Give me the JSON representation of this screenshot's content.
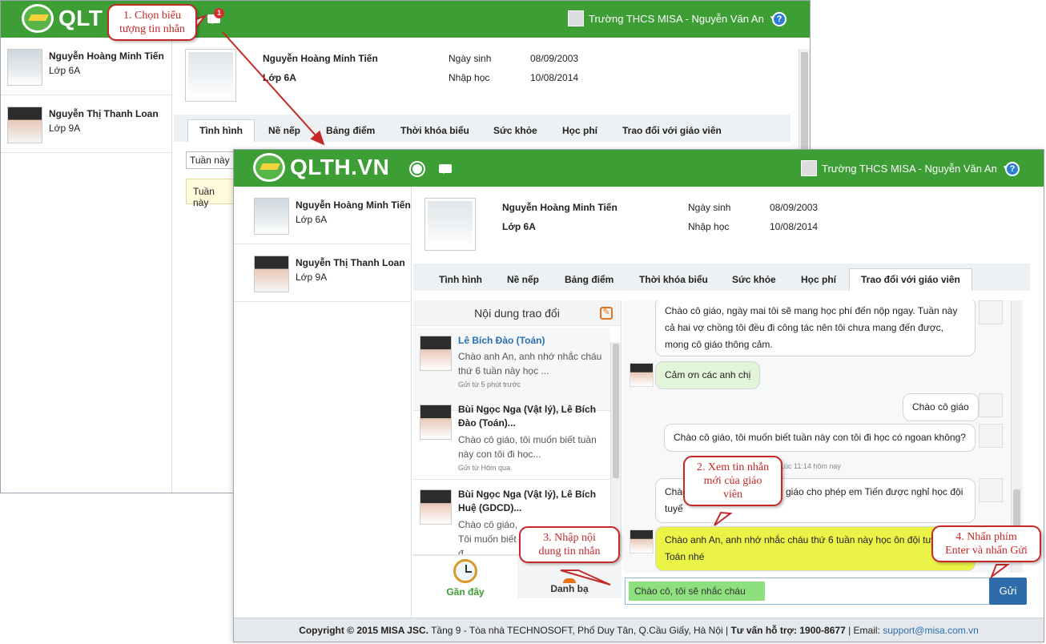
{
  "back_window": {
    "logo_text": "QLT",
    "badge_count": "1",
    "school_user": "Trường THCS MISA - Nguyễn Văn An",
    "help": "?",
    "students": [
      {
        "name": "Nguyễn Hoàng Minh Tiến",
        "class": "Lớp 6A"
      },
      {
        "name": "Nguyễn Thị Thanh Loan",
        "class": "Lớp 9A"
      }
    ],
    "profile": {
      "name": "Nguyễn Hoàng Minh Tiến",
      "class": "Lớp 6A",
      "dob_label": "Ngày sinh",
      "dob": "08/09/2003",
      "enroll_label": "Nhập học",
      "enroll": "10/08/2014"
    },
    "tabs": [
      "Tình hình",
      "Nề nếp",
      "Bảng điểm",
      "Thời khóa biểu",
      "Sức khỏe",
      "Học phí",
      "Trao đổi với giáo viên"
    ],
    "week_select": "Tuần này",
    "week_notice": "Tuần này"
  },
  "front_window": {
    "logo_text": "QLTH.VN",
    "school_user": "Trường THCS MISA - Nguyễn Văn An",
    "help": "?",
    "students": [
      {
        "name": "Nguyễn Hoàng Minh Tiến",
        "class": "Lớp 6A"
      },
      {
        "name": "Nguyễn Thị Thanh Loan",
        "class": "Lớp 9A"
      }
    ],
    "profile": {
      "name": "Nguyễn Hoàng Minh Tiến",
      "class": "Lớp 6A",
      "dob_label": "Ngày sinh",
      "dob": "08/09/2003",
      "enroll_label": "Nhập học",
      "enroll": "10/08/2014"
    },
    "tabs": [
      "Tình hình",
      "Nề nếp",
      "Bảng điểm",
      "Thời khóa biểu",
      "Sức khỏe",
      "Học phí",
      "Trao đổi với giáo viên"
    ],
    "conversation_list": {
      "header": "Nội dung trao đổi",
      "items": [
        {
          "title": "Lê Bích Đào (Toán)",
          "preview1": "Chào anh An, anh nhớ nhắc cháu",
          "preview2": "thứ 6 tuần này học ...",
          "time": "Gửi từ 5 phút trước"
        },
        {
          "title1": "Bùi Ngọc Nga (Vật lý), Lê Bích",
          "title2": "Đào (Toán)...",
          "preview1": "Chào cô giáo, tôi muốn biết tuần",
          "preview2": "này con tôi đi học...",
          "time": "Gửi từ Hôm qua"
        },
        {
          "title1": "Bùi Ngọc Nga (Vật lý), Lê Bích",
          "title2": "Huệ (GDCD)...",
          "preview1": "Chào cô giáo,",
          "preview2": "Tôi muốn biết",
          "preview3": "đ"
        }
      ],
      "bottom_tabs": [
        "Gần đây",
        "Danh bạ"
      ]
    },
    "messages": [
      {
        "line1": "Chào cô giáo, ngày mai tôi sẽ mang học phí đến nộp ngay. Tuần này",
        "line2": "cả hai vợ chồng tôi đều đi công tác nên tôi chưa mang đến được,",
        "line3": "mong cô giáo thông cảm."
      },
      {
        "text": "Cảm ơn các anh chị"
      },
      {
        "text": "Chào cô giáo"
      },
      {
        "text": "Chào cô giáo, tôi muốn biết tuần này con tôi đi học có ngoan không?"
      },
      {
        "line1": "Chào",
        "line1b": "giáo cho phép em Tiến được nghỉ học đội",
        "line2": "tuyể"
      },
      {
        "line1": "Chào anh An, anh nhớ nhắc cháu thứ 6 tuần này học ôn đội tuy",
        "line2": "Toán nhé"
      }
    ],
    "timestamp": "Lúc 11:14 hôm nay",
    "input_value": "Chào cô, tôi sẽ nhắc cháu",
    "send_label": "Gửi",
    "footer": {
      "copyright": "Copyright © 2015 MISA JSC.",
      "address": "Tầng 9 - Tòa nhà TECHNOSOFT, Phố Duy Tân, Q.Cầu Giấy, Hà Nội |",
      "hotline_label": "Tư vấn hỗ trợ: 1900-8677",
      "email_label": "| Email:",
      "email": "support@misa.com.vn"
    }
  },
  "callouts": {
    "c1": [
      "1. Chọn biểu",
      "tượng tin nhắn"
    ],
    "c2": [
      "2. Xem tin nhắn",
      "mới của giáo",
      "viên"
    ],
    "c3": [
      "3. Nhập nội",
      "dung tin nhắn"
    ],
    "c4": [
      "4. Nhấn phím",
      "Enter và nhấn Gửi"
    ]
  },
  "colors": {
    "header_green": "#3d9e35",
    "callout_red": "#c62828",
    "send_blue": "#2d6ca8",
    "highlight_yellow": "#ecf347"
  }
}
